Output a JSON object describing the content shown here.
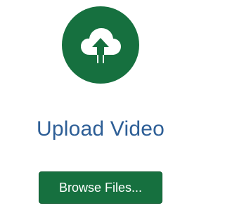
{
  "upload": {
    "icon": "cloud-upload-icon",
    "title": "Upload Video",
    "browse_label": "Browse Files...",
    "accent": "#16703f",
    "title_color": "#2d5e96"
  }
}
